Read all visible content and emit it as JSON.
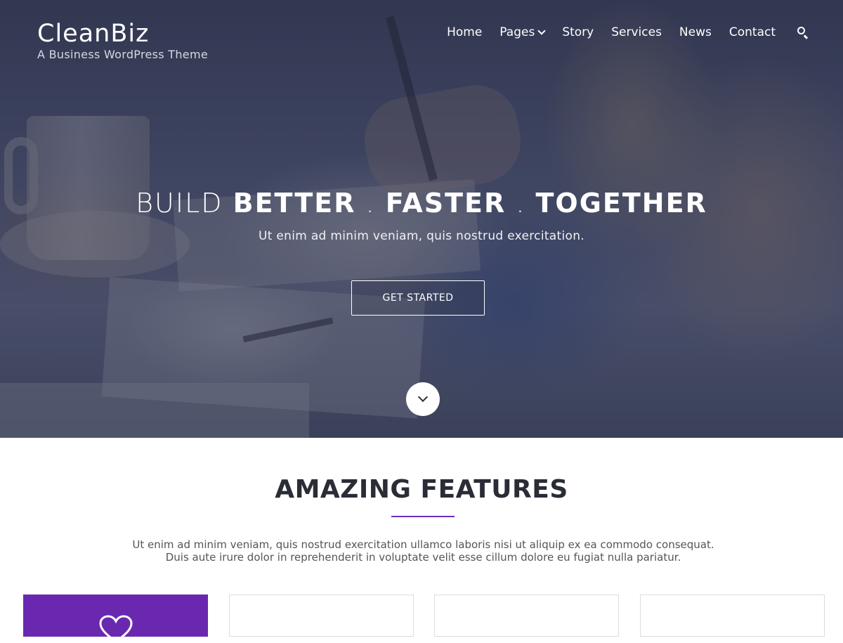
{
  "header": {
    "site_title": "CleanBiz",
    "tagline": "A Business WordPress Theme"
  },
  "nav": {
    "items": [
      {
        "label": "Home",
        "has_dropdown": false
      },
      {
        "label": "Pages",
        "has_dropdown": true
      },
      {
        "label": "Story",
        "has_dropdown": false
      },
      {
        "label": "Services",
        "has_dropdown": false
      },
      {
        "label": "News",
        "has_dropdown": false
      },
      {
        "label": "Contact",
        "has_dropdown": false
      }
    ],
    "search_icon": "search-icon"
  },
  "hero": {
    "title_light": "BUILD",
    "title_part1": "BETTER",
    "separator": " . ",
    "title_part2": "FASTER",
    "title_part3": "TOGETHER",
    "subtitle": "Ut enim ad minim veniam, quis nostrud exercitation.",
    "cta_label": "GET STARTED",
    "scroll_icon": "chevron-down-icon"
  },
  "features": {
    "title": "AMAZING FEATURES",
    "text_line1": "Ut enim ad minim veniam, quis nostrud exercitation ullamco laboris nisi ut aliquip ex ea commodo consequat.",
    "text_line2": "Duis aute irure dolor in reprehenderit in voluptate velit esse cillum dolore eu fugiat nulla pariatur.",
    "cards": [
      {
        "icon": "heart-icon",
        "active": true
      },
      {
        "active": false
      },
      {
        "active": false
      },
      {
        "active": false
      }
    ]
  },
  "colors": {
    "accent": "#6a28b0",
    "hero_overlay": "#2c324e",
    "heading": "#2a2c36"
  }
}
